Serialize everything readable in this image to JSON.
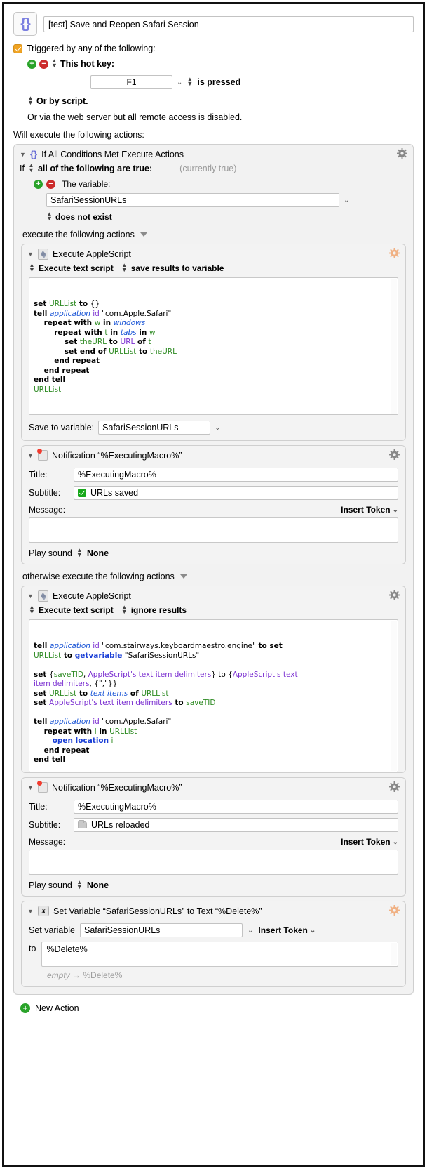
{
  "window": {
    "macro_icon": "{}",
    "macro_name": "[test] Save and Reopen Safari Session"
  },
  "trigger": {
    "checkbox_label": "Triggered by any of the following:",
    "add_label": "+",
    "remove_label": "−",
    "hotkey_label": "This hot key:",
    "hotkey_value": "F1",
    "hotkey_condition": "is pressed",
    "or_by_script": "Or by script.",
    "web_server_note": "Or via the web server but all remote access is disabled."
  },
  "will_execute_label": "Will execute the following actions:",
  "if_action": {
    "icon": "{}",
    "title": "If All Conditions Met Execute Actions",
    "if_label": "If",
    "condition_mode": "all of the following are true:",
    "currently": "(currently true)",
    "the_variable_label": "The variable:",
    "variable_name": "SafariSessionURLs",
    "operator": "does not exist",
    "then_label": "execute the following actions",
    "else_label": "otherwise execute the following actions"
  },
  "applescript_then": {
    "title": "Execute AppleScript",
    "mode": "Execute text script",
    "results": "save results to variable",
    "save_to_variable_label": "Save to variable:",
    "save_to_variable_value": "SafariSessionURLs",
    "code_lines": [
      [
        {
          "t": "set ",
          "c": "k"
        },
        {
          "t": "URLList",
          "c": "v"
        },
        {
          "t": " to ",
          "c": "k"
        },
        {
          "t": "{}",
          "c": "s"
        }
      ],
      [
        {
          "t": "tell ",
          "c": "k"
        },
        {
          "t": "application",
          "c": "app"
        },
        {
          "t": " id",
          "c": "cls"
        },
        {
          "t": " \"com.Apple.Safari\"",
          "c": "s"
        }
      ],
      [
        {
          "t": "    repeat with ",
          "c": "k"
        },
        {
          "t": "w",
          "c": "v"
        },
        {
          "t": " in ",
          "c": "k"
        },
        {
          "t": "windows",
          "c": "app"
        }
      ],
      [
        {
          "t": "        repeat with ",
          "c": "k"
        },
        {
          "t": "t",
          "c": "v"
        },
        {
          "t": " in ",
          "c": "k"
        },
        {
          "t": "tabs",
          "c": "app"
        },
        {
          "t": " in ",
          "c": "k"
        },
        {
          "t": "w",
          "c": "v"
        }
      ],
      [
        {
          "t": "            set ",
          "c": "k"
        },
        {
          "t": "theURL",
          "c": "v"
        },
        {
          "t": " to ",
          "c": "k"
        },
        {
          "t": "URL",
          "c": "cls"
        },
        {
          "t": " of ",
          "c": "k"
        },
        {
          "t": "t",
          "c": "v"
        }
      ],
      [
        {
          "t": "            set end of ",
          "c": "k"
        },
        {
          "t": "URLList",
          "c": "v"
        },
        {
          "t": " to ",
          "c": "k"
        },
        {
          "t": "theURL",
          "c": "v"
        }
      ],
      [
        {
          "t": "        end repeat",
          "c": "k"
        }
      ],
      [
        {
          "t": "    end repeat",
          "c": "k"
        }
      ],
      [
        {
          "t": "end tell",
          "c": "k"
        }
      ],
      [
        {
          "t": "URLList",
          "c": "v"
        }
      ]
    ]
  },
  "notification_then": {
    "title": "Notification “%ExecutingMacro%”",
    "title_label": "Title:",
    "title_value": "%ExecutingMacro%",
    "subtitle_label": "Subtitle:",
    "subtitle_value": "URLs saved",
    "subtitle_emoji": "white-check-mark",
    "message_label": "Message:",
    "message_value": "",
    "insert_token": "Insert Token",
    "play_sound_label": "Play sound",
    "play_sound_value": "None"
  },
  "applescript_else": {
    "title": "Execute AppleScript",
    "mode": "Execute text script",
    "results": "ignore results",
    "code_lines": [
      [
        {
          "t": "tell ",
          "c": "k"
        },
        {
          "t": "application",
          "c": "app"
        },
        {
          "t": " id",
          "c": "cls"
        },
        {
          "t": " \"com.stairways.keyboardmaestro.engine\"",
          "c": "s"
        },
        {
          "t": " to set",
          "c": "k"
        }
      ],
      [
        {
          "t": "URLList",
          "c": "v"
        },
        {
          "t": " to ",
          "c": "k"
        },
        {
          "t": "getvariable",
          "c": "fn"
        },
        {
          "t": " \"SafariSessionURLs\"",
          "c": "s"
        }
      ],
      [
        {
          "t": "",
          "c": "s"
        }
      ],
      [
        {
          "t": "set ",
          "c": "k"
        },
        {
          "t": "{",
          "c": "s"
        },
        {
          "t": "saveTID",
          "c": "v"
        },
        {
          "t": ", ",
          "c": "s"
        },
        {
          "t": "AppleScript's text item delimiters",
          "c": "cls"
        },
        {
          "t": "} to {",
          "c": "s"
        },
        {
          "t": "AppleScript's text",
          "c": "cls"
        }
      ],
      [
        {
          "t": "item delimiters",
          "c": "cls"
        },
        {
          "t": ", {\",\"}}",
          "c": "s"
        }
      ],
      [
        {
          "t": "set ",
          "c": "k"
        },
        {
          "t": "URLList",
          "c": "v"
        },
        {
          "t": " to ",
          "c": "k"
        },
        {
          "t": "text items",
          "c": "app"
        },
        {
          "t": " of ",
          "c": "k"
        },
        {
          "t": "URLList",
          "c": "v"
        }
      ],
      [
        {
          "t": "set ",
          "c": "k"
        },
        {
          "t": "AppleScript's text item delimiters",
          "c": "cls"
        },
        {
          "t": " to ",
          "c": "k"
        },
        {
          "t": "saveTID",
          "c": "v"
        }
      ],
      [
        {
          "t": "",
          "c": "s"
        }
      ],
      [
        {
          "t": "tell ",
          "c": "k"
        },
        {
          "t": "application",
          "c": "app"
        },
        {
          "t": " id",
          "c": "cls"
        },
        {
          "t": " \"com.Apple.Safari\"",
          "c": "s"
        }
      ],
      [
        {
          "t": "    repeat with ",
          "c": "k"
        },
        {
          "t": "i",
          "c": "v"
        },
        {
          "t": " in ",
          "c": "k"
        },
        {
          "t": "URLList",
          "c": "v"
        }
      ],
      [
        {
          "t": "        ",
          "c": "s"
        },
        {
          "t": "open location",
          "c": "fn"
        },
        {
          "t": " i",
          "c": "v"
        }
      ],
      [
        {
          "t": "    end repeat",
          "c": "k"
        }
      ],
      [
        {
          "t": "end tell",
          "c": "k"
        }
      ]
    ]
  },
  "notification_else": {
    "title": "Notification “%ExecutingMacro%”",
    "title_label": "Title:",
    "title_value": "%ExecutingMacro%",
    "subtitle_label": "Subtitle:",
    "subtitle_value": "URLs reloaded",
    "subtitle_emoji": "open-file-folder",
    "message_label": "Message:",
    "message_value": "",
    "insert_token": "Insert Token",
    "play_sound_label": "Play sound",
    "play_sound_value": "None"
  },
  "set_variable": {
    "icon": "X",
    "title": "Set Variable “SafariSessionURLs” to Text “%Delete%”",
    "set_variable_label": "Set variable",
    "variable_name": "SafariSessionURLs",
    "insert_token": "Insert Token",
    "to_label": "to",
    "to_value": "%Delete%",
    "preview_empty": "empty",
    "preview_arrow": "→",
    "preview_value": "%Delete%"
  },
  "new_action": {
    "label": "New Action"
  },
  "colors": {
    "accent_orange": "#f0a322",
    "add_green": "#2aa32a",
    "remove_red": "#cc2b2b",
    "action_bg": "#f3f3f3",
    "code_var_green": "#2d8a22",
    "code_class_purple": "#7b2fd1",
    "code_app_blue": "#1a55d6"
  }
}
